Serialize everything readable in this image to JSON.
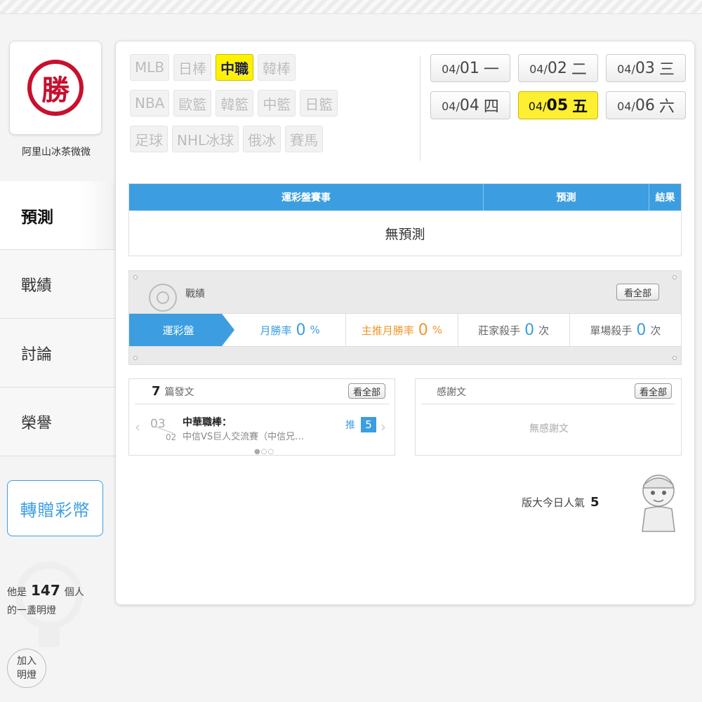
{
  "user": {
    "name": "阿里山冰茶微微",
    "avatar_char": "勝"
  },
  "nav": {
    "items": [
      {
        "label": "預測",
        "active": true
      },
      {
        "label": "戰績",
        "active": false
      },
      {
        "label": "討論",
        "active": false
      },
      {
        "label": "榮譽",
        "active": false
      }
    ],
    "donate_label": "轉贈彩幣"
  },
  "light": {
    "prefix": "他是",
    "count": "147",
    "suffix": "個人",
    "line2": "的一盞明燈",
    "join_line1": "加入",
    "join_line2": "明燈"
  },
  "leagues": {
    "row1": [
      "MLB",
      "日棒",
      "中職",
      "韓棒"
    ],
    "row2": [
      "NBA",
      "歐籃",
      "韓籃",
      "中籃",
      "日籃"
    ],
    "row3": [
      "足球",
      "NHL冰球",
      "俄冰",
      "賽馬"
    ],
    "active": "中職"
  },
  "dates": [
    {
      "md": "04/",
      "day": "01",
      "wd": "一"
    },
    {
      "md": "04/",
      "day": "02",
      "wd": "二"
    },
    {
      "md": "04/",
      "day": "03",
      "wd": "三"
    },
    {
      "md": "04/",
      "day": "04",
      "wd": "四"
    },
    {
      "md": "04/",
      "day": "05",
      "wd": "五",
      "active": true
    },
    {
      "md": "04/",
      "day": "06",
      "wd": "六"
    }
  ],
  "prediction": {
    "col_event": "運彩盤賽事",
    "col_pred": "預測",
    "col_result": "結果",
    "empty": "無預測"
  },
  "record": {
    "title": "戰績",
    "view_all": "看全部",
    "tab": "運彩盤",
    "monthly_label": "月勝率",
    "monthly_value": "0",
    "main_label": "主推月勝率",
    "main_value": "0",
    "banker_label": "莊家殺手",
    "banker_value": "0",
    "single_label": "單場殺手",
    "single_value": "0",
    "percent": "%",
    "times": "次"
  },
  "posts": {
    "count": "7",
    "label": "篇發文",
    "view_all": "看全部",
    "item": {
      "day": "03",
      "month": "02",
      "title": "中華職棒：",
      "subtitle": "中信VS巨人交流賽（中信兄…",
      "push_label": "推",
      "push_count": "5"
    },
    "pager": "●○○"
  },
  "thanks": {
    "label": "感謝文",
    "view_all": "看全部",
    "empty": "無感謝文"
  },
  "popularity": {
    "label": "版大今日人氣",
    "value": "5"
  },
  "colors": {
    "accent": "#3c9ee0",
    "highlight": "#fff200",
    "seal": "#c8102e",
    "orange": "#f0962c"
  }
}
